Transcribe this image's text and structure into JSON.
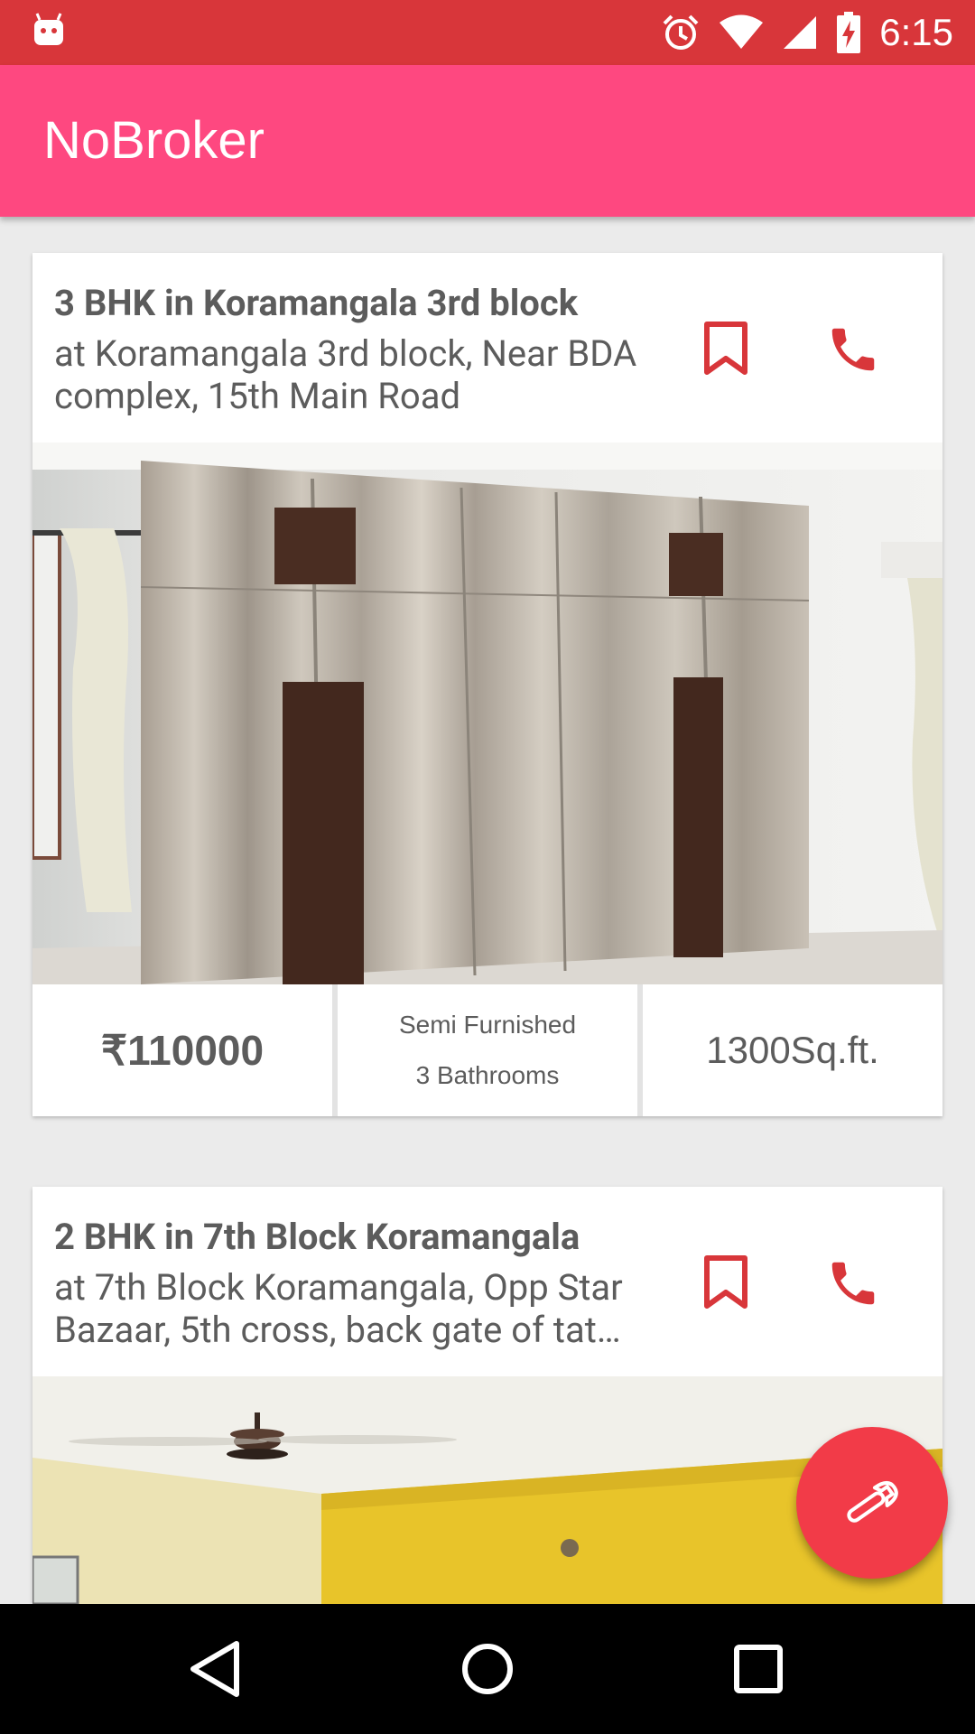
{
  "status_bar": {
    "time": "6:15",
    "icons": [
      "android-notification-icon",
      "alarm-icon",
      "wifi-icon",
      "signal-icon",
      "battery-charging-icon"
    ],
    "color": "#d8363a"
  },
  "app_bar": {
    "title": "NoBroker",
    "color": "#fe4880"
  },
  "listings": [
    {
      "title": "3 BHK in Koramangala 3rd block",
      "address": "at Koramangala 3rd block, Near BDA complex, 15th Main Road",
      "price": "₹110000",
      "furnishing": "Semi Furnished",
      "bathrooms": "3 Bathrooms",
      "area": "1300Sq.ft.",
      "photo": "wardrobe-room-photo"
    },
    {
      "title": "2 BHK in 7th Block Koramangala",
      "address": "at 7th Block Koramangala, Opp Star Bazaar, 5th cross, back gate of tat…",
      "photo": "yellow-room-ceiling-fan-photo"
    }
  ],
  "fab": {
    "icon": "wrench-icon",
    "color": "#f23b48"
  },
  "nav_bar": {
    "icons": [
      "back-icon",
      "home-icon",
      "recents-icon"
    ]
  },
  "accent": "#d8363a"
}
